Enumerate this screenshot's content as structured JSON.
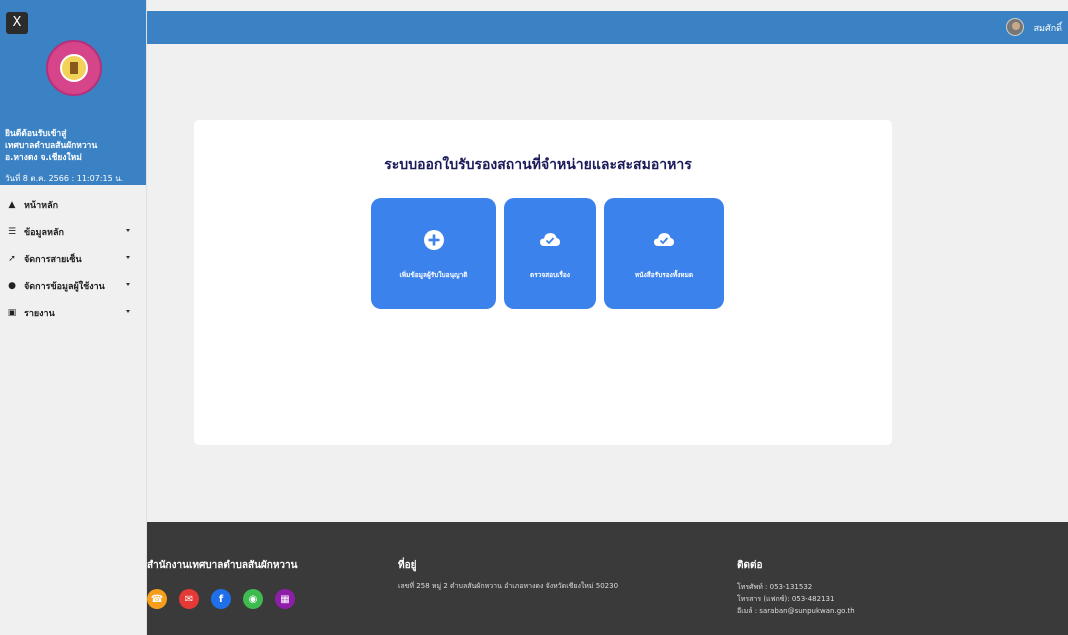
{
  "sidebar": {
    "close_label": "X",
    "welcome_lines": [
      "ยินดีต้อนรับเข้าสู่",
      "เทศบาลตำบลสันผักหวาน",
      "อ.หางดง จ.เชียงใหม่"
    ],
    "datetime": "วันที่ 8 ต.ค. 2566 : 11:07:15 น.",
    "menu": [
      {
        "label": "หน้าหลัก",
        "icon": "home-icon",
        "has_caret": false
      },
      {
        "label": "ข้อมูลหลัก",
        "icon": "database-icon",
        "has_caret": true
      },
      {
        "label": "จัดการสายเซ็น",
        "icon": "signature-icon",
        "has_caret": true
      },
      {
        "label": "จัดการข้อมูลผู้ใช้งาน",
        "icon": "users-icon",
        "has_caret": true
      },
      {
        "label": "รายงาน",
        "icon": "report-icon",
        "has_caret": true
      }
    ]
  },
  "topbar": {
    "username": "สมศักดิ์"
  },
  "main": {
    "title": "ระบบออกใบรับรองสถานที่จำหน่ายและสะสมอาหาร",
    "tiles": [
      {
        "label": "เพิ่มข้อมูลผู้รับใบอนุญาติ",
        "icon": "plus-circle-icon"
      },
      {
        "label": "ตรวจสอบเรื่อง",
        "icon": "cloud-check-icon"
      },
      {
        "label": "หนังสือรับรองทั้งหมด",
        "icon": "cloud-check-icon"
      }
    ]
  },
  "footer": {
    "org_title": "สำนักงานเทศบาลตำบลสันผักหวาน",
    "address_title": "ที่อยู่",
    "address": "เลขที่ 258 หมู่ 2 ตำบลสันผักหวาน อำเภอหางดง จังหวัดเชียงใหม่ 50230",
    "contact_title": "ติดต่อ",
    "phone": "โทรศัพท์ : 053-131532",
    "fax": "โทรสาร (แฟกซ์): 053-482131",
    "email": "อีเมล์ : saraban@sunpukwan.go.th",
    "socials": [
      {
        "icon": "phone-icon",
        "color": "#f59e1b"
      },
      {
        "icon": "mail-icon",
        "color": "#e53935"
      },
      {
        "icon": "facebook-icon",
        "color": "#1e6fe8"
      },
      {
        "icon": "line-icon",
        "color": "#3dbb4e"
      },
      {
        "icon": "calendar-icon",
        "color": "#8e1ea8"
      }
    ]
  },
  "colors": {
    "primary": "#3b82c4",
    "tile": "#3b82ed",
    "footer": "#3a3a3a"
  }
}
